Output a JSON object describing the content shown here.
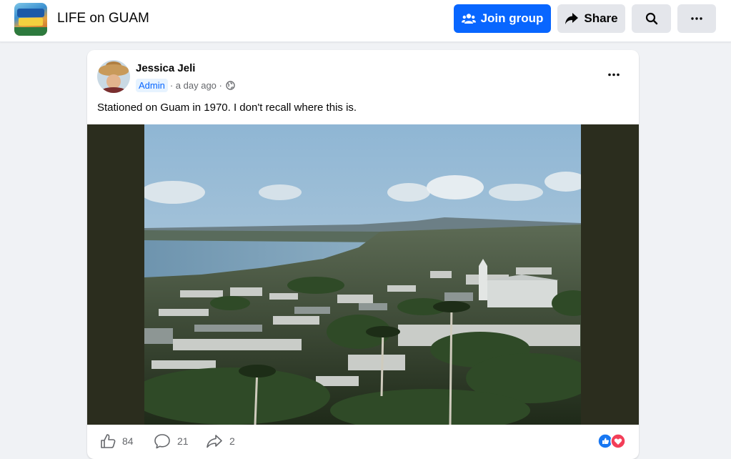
{
  "header": {
    "group_name": "LIFE on GUAM",
    "join_label": "Join group",
    "share_label": "Share"
  },
  "post": {
    "author": "Jessica Jeli",
    "role_badge": "Admin",
    "time": "· a day ago ·",
    "text": "Stationed on Guam in 1970. I don't recall where this is.",
    "likes": "84",
    "comments": "21",
    "shares": "2"
  },
  "colors": {
    "accent": "#0866ff",
    "reaction_like": "#1877f2",
    "reaction_love": "#f33e58"
  },
  "icons": {
    "join": "people-icon",
    "share": "share-arrow-icon",
    "search": "search-icon",
    "more": "more-dots-icon",
    "privacy": "globe-icon",
    "like": "thumbs-up-icon",
    "comment": "comment-bubble-icon",
    "share_post": "share-outline-icon"
  }
}
